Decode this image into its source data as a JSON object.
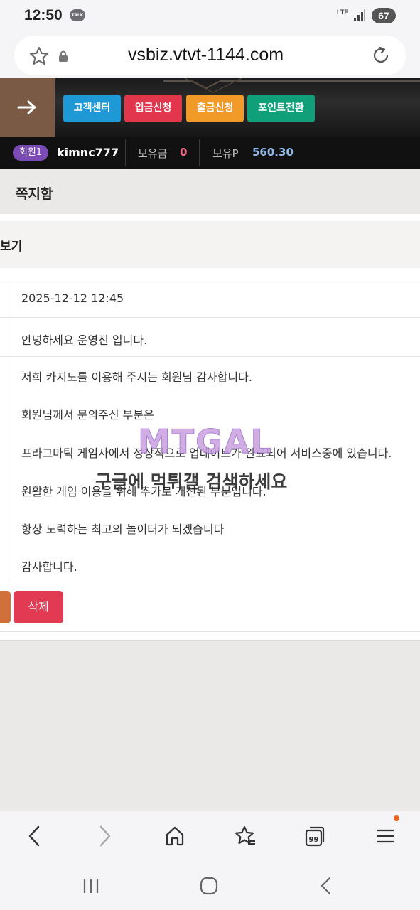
{
  "status": {
    "time": "12:50",
    "talk_icon": "TALK",
    "network": "LTE",
    "battery": "67"
  },
  "browser": {
    "url": "vsbiz.vtvt-1144.com"
  },
  "header": {
    "buttons": [
      "고객센터",
      "입금신청",
      "출금신청",
      "포인트전환"
    ]
  },
  "member": {
    "level": "회원1",
    "username": "kimnc777",
    "money_label": "보유금",
    "money_value": "0",
    "point_label": "보유P",
    "point_value": "560.30"
  },
  "page": {
    "title": "쪽지함",
    "section_title": "보기",
    "date": "2025-12-12 12:45",
    "subject": "안녕하세요 운영진 입니다.",
    "body_lines": [
      "저희 카지노를 이용해 주시는 회원님 감사합니다.",
      "회원님께서 문의주신 부분은",
      "프라그마틱 게임사에서 정상적으로 업데이트가 완료되어 서비스중에 있습니다.",
      "원활한 게임 이용을 위해 추가로 개선된 부분입니다.",
      "항상 노력하는 최고의 놀이터가 되겠습니다",
      "감사합니다."
    ],
    "delete_label": "삭제"
  },
  "watermark": {
    "logo": "MTGAL",
    "text": "구글에 먹튀갤 검색하세요"
  },
  "colors": {
    "support": "#1f98d6",
    "deposit": "#e2364d",
    "withdraw": "#f19a28",
    "point": "#0fa07a",
    "delete": "#e23a52",
    "level_badge": "#7b4bb5"
  },
  "icons": {
    "browser_nav": [
      "back-icon",
      "forward-icon",
      "home-icon",
      "bookmark-star-icon",
      "tabs-icon",
      "menu-icon"
    ],
    "tabs_count": "99"
  }
}
